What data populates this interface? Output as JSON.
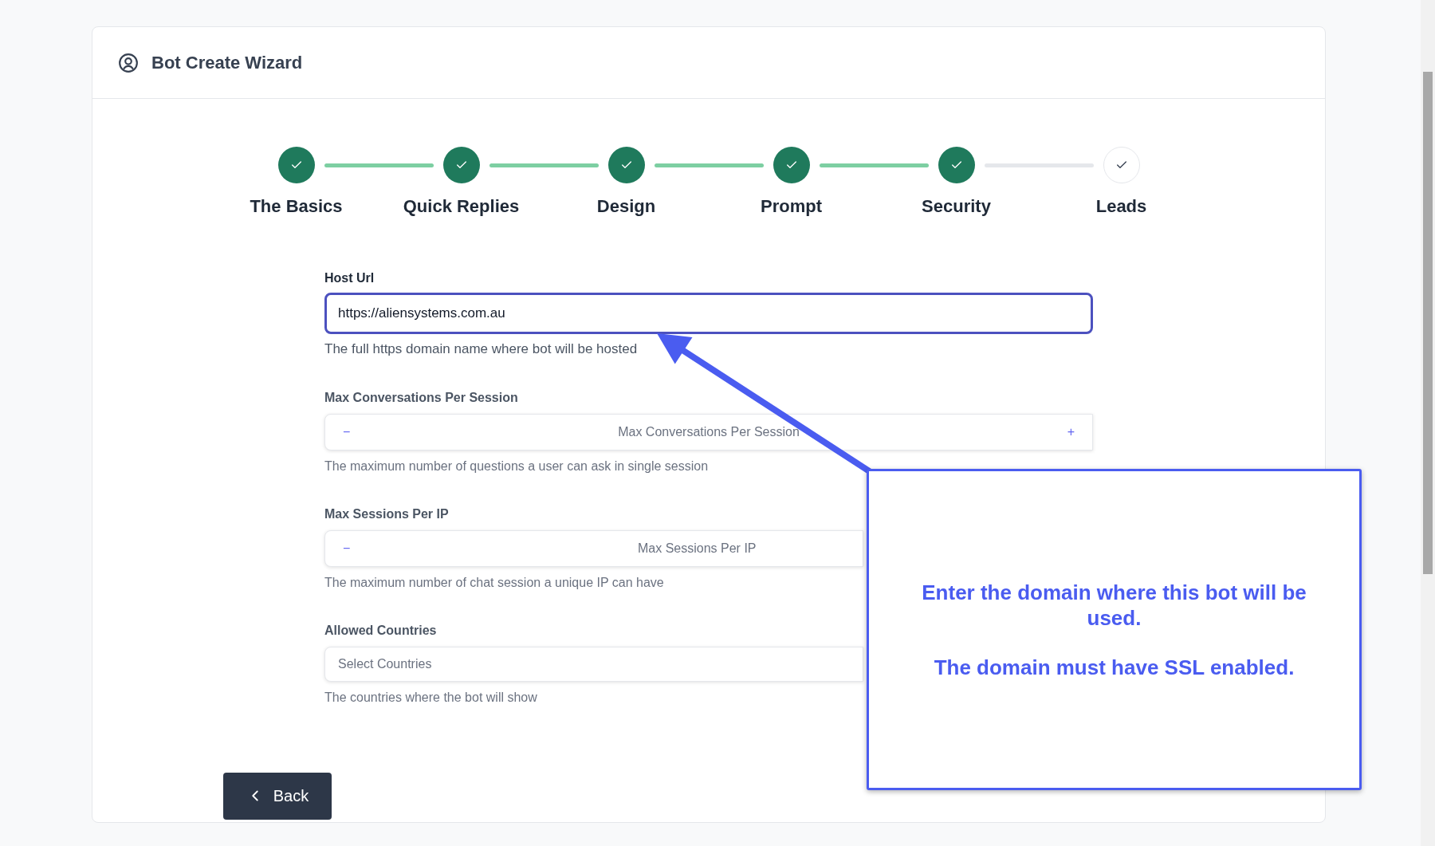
{
  "header": {
    "title": "Bot Create Wizard"
  },
  "steps": [
    {
      "label": "The Basics",
      "completed": true
    },
    {
      "label": "Quick Replies",
      "completed": true
    },
    {
      "label": "Design",
      "completed": true
    },
    {
      "label": "Prompt",
      "completed": true
    },
    {
      "label": "Security",
      "completed": true
    },
    {
      "label": "Leads",
      "completed": false
    }
  ],
  "host_url": {
    "label": "Host Url",
    "value": "https://aliensystems.com.au",
    "focused": true,
    "help": "The full https domain name where bot will be hosted"
  },
  "blurred_section": {
    "fields": [
      {
        "kind": "stepper",
        "label": "Max Conversations Per Session",
        "placeholder": "Max Conversations Per Session",
        "minus": "−",
        "plus": "+",
        "help": "The maximum number of questions a user can ask in single session",
        "covered": false
      },
      {
        "kind": "stepper",
        "label": "Max Sessions Per IP",
        "placeholder": "Max Sessions Per IP",
        "minus": "−",
        "help": "The maximum number of chat session a unique IP can have",
        "covered": true
      },
      {
        "kind": "select",
        "label": "Allowed Countries",
        "placeholder": "Select Countries",
        "help": "The countries where the bot will show",
        "covered": true
      }
    ]
  },
  "back_button": {
    "label": "Back"
  },
  "callout": {
    "lines": [
      "Enter the domain where this bot will be used.",
      "The domain must have SSL enabled."
    ]
  }
}
